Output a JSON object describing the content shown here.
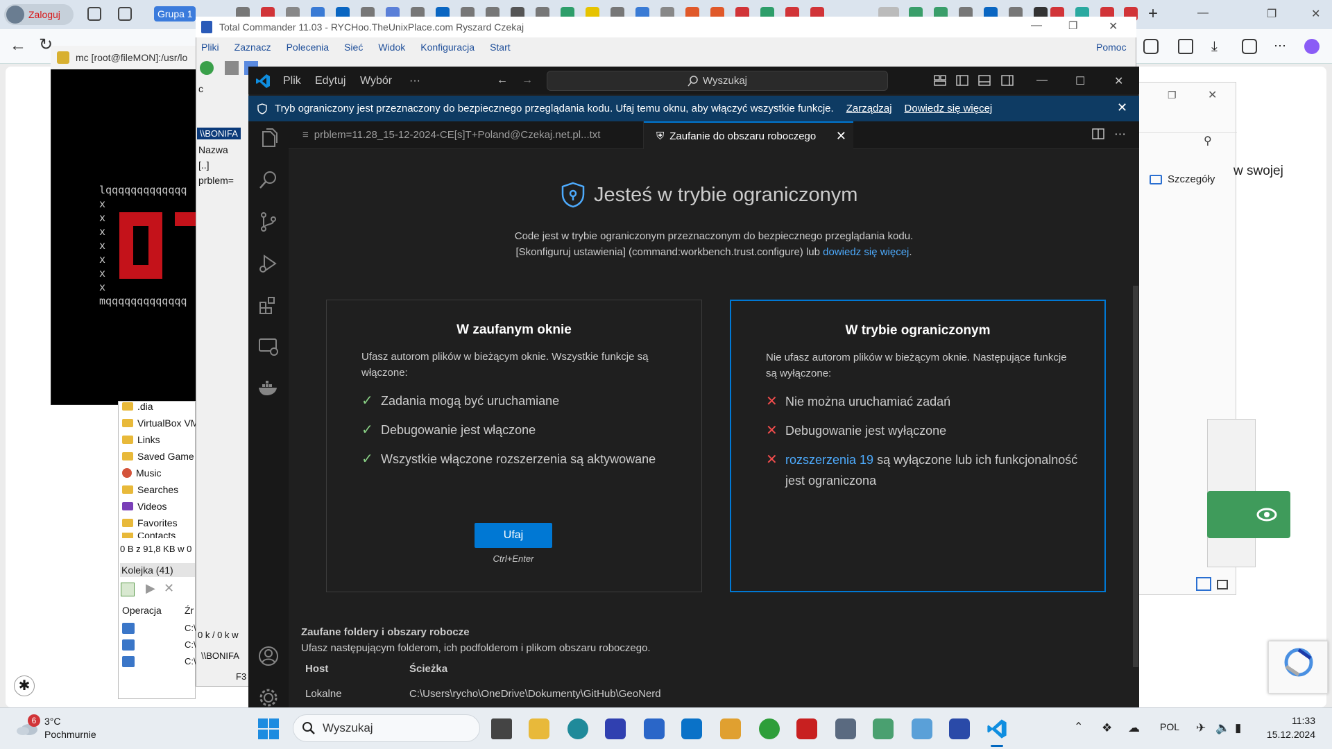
{
  "browser": {
    "profile_label": "Zaloguj",
    "tab_group_label": "Grupa 1",
    "new_tab_glyph": "+",
    "right_panel": {
      "details_label": "Szczegóły",
      "partial_heading": "w swojej"
    }
  },
  "mc": {
    "title": "mc [root@fileMON]:/usr/lo",
    "art_lines": [
      "lqqqqqqqqqqqqq",
      "x",
      "x",
      "x",
      "x",
      "x",
      "x",
      "x",
      "mqqqqqqqqqqqqq"
    ]
  },
  "explorer": {
    "folders": [
      {
        "label": ".dia",
        "icon": "folder-icon"
      },
      {
        "label": "VirtualBox VM",
        "icon": "folder-icon"
      },
      {
        "label": "Links",
        "icon": "folder-icon"
      },
      {
        "label": "Saved Game",
        "icon": "folder-icon"
      },
      {
        "label": "Music",
        "icon": "music-icon"
      },
      {
        "label": "Searches",
        "icon": "folder-icon"
      },
      {
        "label": "Videos",
        "icon": "video-icon"
      },
      {
        "label": "Favorites",
        "icon": "folder-icon"
      },
      {
        "label": "Contacts",
        "icon": "folder-icon"
      }
    ],
    "status": "0 B z 91,8 KB w 0",
    "queue_label": "Kolejka (41)",
    "col_operation": "Operacja",
    "col_source": "Źr",
    "row_values": [
      "C:\\",
      "C:\\",
      "C:\\"
    ]
  },
  "total_commander": {
    "title": "Total Commander 11.03 - RYCHoo.TheUnixPlace.com Ryszard Czekaj",
    "menu": [
      "Pliki",
      "Zaznacz",
      "Polecenia",
      "Sieć",
      "Widok",
      "Konfiguracja",
      "Start"
    ],
    "help": "Pomoc",
    "drive_c": "c",
    "path_unc": "\\\\BONIFA",
    "col_name": "Nazwa",
    "updir": "[..]",
    "file": "prblem=",
    "size_status": "0 k / 0 k w",
    "path2": "\\\\BONIFA",
    "f3": "F3"
  },
  "vscode": {
    "menu": [
      "Plik",
      "Edytuj",
      "Wybór"
    ],
    "more_menu": "···",
    "search_placeholder": "Wyszukaj",
    "banner": {
      "text": "Tryb ograniczony jest przeznaczony do bezpiecznego przeglądania kodu. Ufaj temu oknu, aby włączyć wszystkie funkcje.",
      "manage": "Zarządzaj",
      "learn_more": "Dowiedz się więcej"
    },
    "tabs": [
      {
        "label": "prblem=11.28_15-12-2024-CE[s]T+Poland@Czekaj.net.pl...txt",
        "icon": "file-lines-icon"
      },
      {
        "label": "Zaufanie do obszaru roboczego",
        "icon": "shield-icon",
        "active": true
      }
    ],
    "trust_page": {
      "title": "Jesteś w trybie ograniczonym",
      "desc_line1": "Code jest w trybie ograniczonym przeznaczonym do bezpiecznego przeglądania kodu.",
      "desc_line2_prefix": "[Skonfiguruj ustawienia] (command:workbench.trust.configure) lub ",
      "desc_line2_link": "dowiedz się więcej",
      "desc_line2_suffix": ".",
      "trusted_card": {
        "title": "W zaufanym oknie",
        "desc": "Ufasz autorom plików w bieżącym oknie. Wszystkie funkcje są włączone:",
        "items": [
          "Zadania mogą być uruchamiane",
          "Debugowanie jest włączone",
          "Wszystkie włączone rozszerzenia są aktywowane"
        ],
        "button": "Ufaj",
        "shortcut": "Ctrl+Enter"
      },
      "restricted_card": {
        "title": "W trybie ograniczonym",
        "desc": "Nie ufasz autorom plików w bieżącym oknie. Następujące funkcje są wyłączone:",
        "items": [
          "Nie można uruchamiać zadań",
          "Debugowanie jest wyłączone"
        ],
        "ext_link": "rozszerzenia 19",
        "ext_suffix": " są wyłączone lub ich funkcjonalność jest ograniczona"
      },
      "trusted_folders": {
        "title": "Zaufane foldery i obszary robocze",
        "desc": "Ufasz następującym folderom, ich podfolderom i plikom obszaru roboczego.",
        "col_host": "Host",
        "col_path": "Ścieżka",
        "rows": [
          {
            "host": "Lokalne",
            "path": "C:\\Users\\rycho\\OneDrive\\Dokumenty\\GitHub\\GeoNerd"
          }
        ]
      }
    }
  },
  "taskbar": {
    "weather_badge": "6",
    "weather_temp": "3°C",
    "weather_desc": "Pochmurnie",
    "search_placeholder": "Wyszukaj",
    "lang": "POL",
    "time": "11:33",
    "date": "15.12.2024",
    "apps": [
      "task-view-icon",
      "file-explorer-icon",
      "edge-icon",
      "save-app-icon",
      "store-icon",
      "outlook-icon",
      "colorful-app-icon",
      "green-app-icon",
      "red-app-icon",
      "network-app-icon",
      "scanner-app-icon",
      "monitor-app-icon",
      "letter-a-app-icon",
      "vscode-icon"
    ]
  },
  "colors": {
    "vscode_bg": "#1f1f1f",
    "vscode_accent": "#0078d4",
    "banner_bg": "#0e3b63",
    "check": "#89d185",
    "cross": "#f14c4c",
    "link": "#4daafc"
  }
}
